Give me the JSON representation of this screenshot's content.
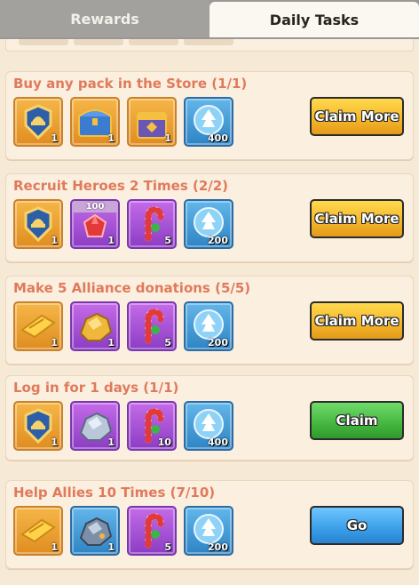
{
  "tabs": {
    "rewards": "Rewards",
    "daily_tasks": "Daily Tasks"
  },
  "tasks": [
    {
      "title": "Buy any pack in the Store (1/1)",
      "button": "Claim More",
      "items": [
        {
          "icon": "hero-badge-icon",
          "qty": "1"
        },
        {
          "icon": "blue-chest-icon",
          "qty": "1"
        },
        {
          "icon": "gold-chest-icon",
          "qty": "1"
        },
        {
          "icon": "crystal-shard-icon",
          "qty": "400"
        }
      ]
    },
    {
      "title": "Recruit Heroes 2 Times (2/2)",
      "button": "Claim More",
      "items": [
        {
          "icon": "hero-badge-icon",
          "qty": "1"
        },
        {
          "icon": "ruby-gem-icon",
          "qty": "1",
          "badge": "100"
        },
        {
          "icon": "candy-cane-icon",
          "qty": "5"
        },
        {
          "icon": "crystal-shard-icon",
          "qty": "200"
        }
      ]
    },
    {
      "title": "Make 5 Alliance donations (5/5)",
      "button": "Claim More",
      "items": [
        {
          "icon": "gold-ticket-icon",
          "qty": "1"
        },
        {
          "icon": "gold-ore-icon",
          "qty": "1"
        },
        {
          "icon": "candy-cane-icon",
          "qty": "5"
        },
        {
          "icon": "crystal-shard-icon",
          "qty": "200"
        }
      ]
    },
    {
      "title": "Log in for 1 days (1/1)",
      "button": "Claim",
      "items": [
        {
          "icon": "hero-badge-icon",
          "qty": "1"
        },
        {
          "icon": "silver-ore-icon",
          "qty": "1"
        },
        {
          "icon": "candy-cane-icon",
          "qty": "10"
        },
        {
          "icon": "crystal-shard-icon",
          "qty": "400"
        }
      ]
    },
    {
      "title": "Help Allies 10 Times (7/10)",
      "button": "Go",
      "items": [
        {
          "icon": "gold-ticket-icon",
          "qty": "1"
        },
        {
          "icon": "iron-ore-icon",
          "qty": "1"
        },
        {
          "icon": "candy-cane-icon",
          "qty": "5"
        },
        {
          "icon": "crystal-shard-icon",
          "qty": "200"
        }
      ]
    }
  ],
  "colors": {
    "title": "#e07a5c",
    "button_yellow": "#f4b52a",
    "button_green": "#44b63f",
    "button_blue": "#3a9ee8"
  }
}
